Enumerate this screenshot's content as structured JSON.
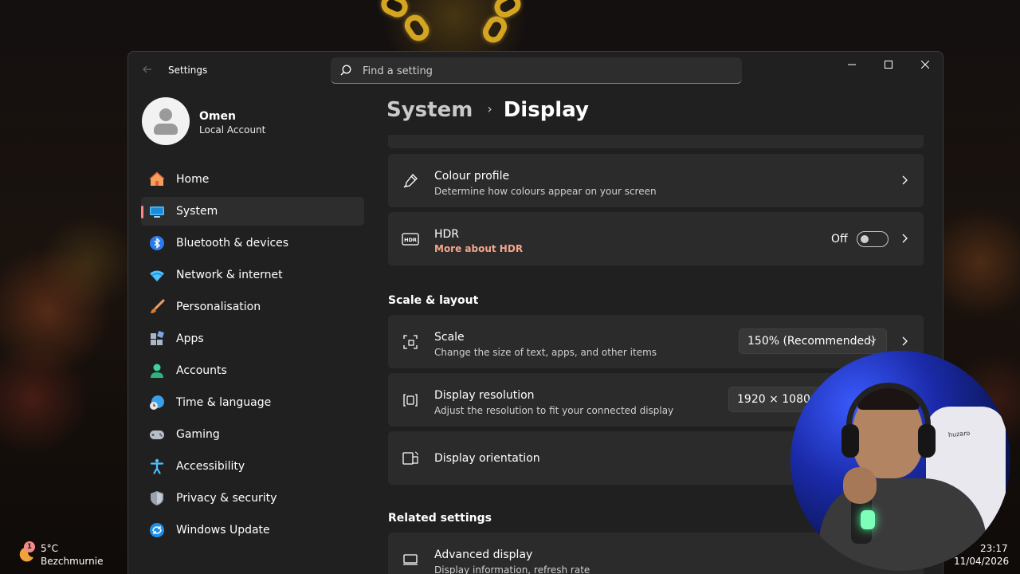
{
  "window": {
    "app_title": "Settings"
  },
  "search": {
    "placeholder": "Find a setting"
  },
  "profile": {
    "name": "Omen",
    "account_type": "Local Account"
  },
  "sidebar": {
    "items": [
      {
        "label": "Home",
        "icon": "home-icon"
      },
      {
        "label": "System",
        "icon": "system-icon",
        "active": true
      },
      {
        "label": "Bluetooth & devices",
        "icon": "bluetooth-icon"
      },
      {
        "label": "Network & internet",
        "icon": "wifi-icon"
      },
      {
        "label": "Personalisation",
        "icon": "brush-icon"
      },
      {
        "label": "Apps",
        "icon": "apps-icon"
      },
      {
        "label": "Accounts",
        "icon": "person-icon"
      },
      {
        "label": "Time & language",
        "icon": "clock-globe-icon"
      },
      {
        "label": "Gaming",
        "icon": "gamepad-icon"
      },
      {
        "label": "Accessibility",
        "icon": "accessibility-icon"
      },
      {
        "label": "Privacy & security",
        "icon": "shield-icon"
      },
      {
        "label": "Windows Update",
        "icon": "update-icon"
      }
    ]
  },
  "breadcrumb": {
    "parent": "System",
    "separator": "›",
    "current": "Display"
  },
  "cards": {
    "colour_profile": {
      "title": "Colour profile",
      "desc": "Determine how colours appear on your screen"
    },
    "hdr": {
      "title": "HDR",
      "link": "More about HDR",
      "toggle_label": "Off",
      "toggle_on": false
    },
    "scale": {
      "title": "Scale",
      "desc": "Change the size of text, apps, and other items",
      "value": "150% (Recommended)"
    },
    "resolution": {
      "title": "Display resolution",
      "desc": "Adjust the resolution to fit your connected display",
      "value": "1920 × 1080 (R"
    },
    "orientation": {
      "title": "Display orientation"
    },
    "advanced": {
      "title": "Advanced display",
      "desc": "Display information, refresh rate"
    }
  },
  "sections": {
    "scale_layout": "Scale & layout",
    "related": "Related settings"
  },
  "webcam": {
    "chair_brand": "huzaro"
  },
  "taskbar": {
    "weather_badge": "1",
    "temperature": "5°C",
    "location": "Bezchmurnie",
    "time": "23:17",
    "date": "11/04/2026"
  },
  "colors": {
    "accent": "#ff8585",
    "link": "#f4a58a",
    "window_bg": "#202020",
    "card_bg": "#2b2b2b"
  }
}
